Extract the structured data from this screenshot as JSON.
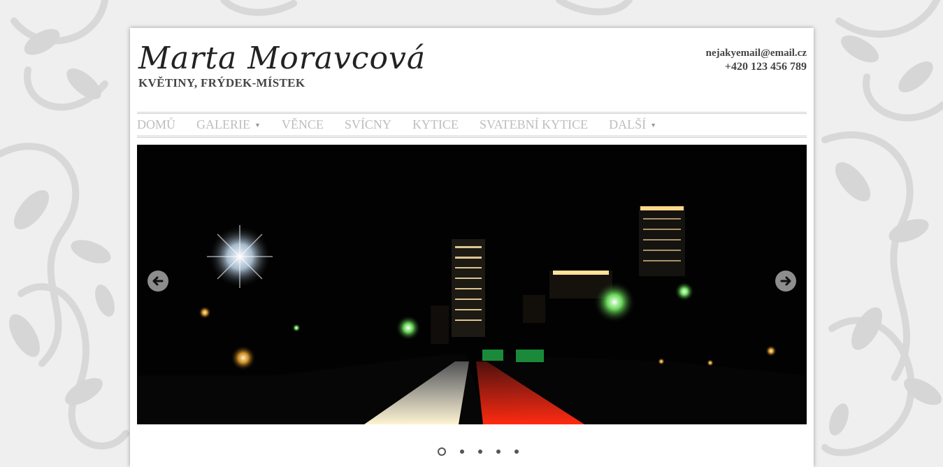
{
  "header": {
    "title": "Marta Moravcová",
    "subtitle": "KVĚTINY, FRÝDEK-MÍSTEK",
    "email": "nejakyemail@email.cz",
    "phone": "+420 123 456 789"
  },
  "nav": {
    "items": [
      {
        "label": "DOMŮ",
        "dropdown": false
      },
      {
        "label": "GALERIE",
        "dropdown": true
      },
      {
        "label": "VĚNCE",
        "dropdown": false
      },
      {
        "label": "SVÍCNY",
        "dropdown": false
      },
      {
        "label": "KYTICE",
        "dropdown": false
      },
      {
        "label": "SVATEBNÍ KYTICE",
        "dropdown": false
      },
      {
        "label": "DALŠÍ",
        "dropdown": true
      }
    ],
    "caret_icon": "chevron-down-icon"
  },
  "slider": {
    "slide_count": 5,
    "active_slide": 1,
    "prev_icon": "arrow-left-icon",
    "next_icon": "arrow-right-icon"
  },
  "colors": {
    "background": "#efefef",
    "ornament": "#d6d6d6",
    "nav_text": "#bdbdbd",
    "title_text": "#222222"
  }
}
